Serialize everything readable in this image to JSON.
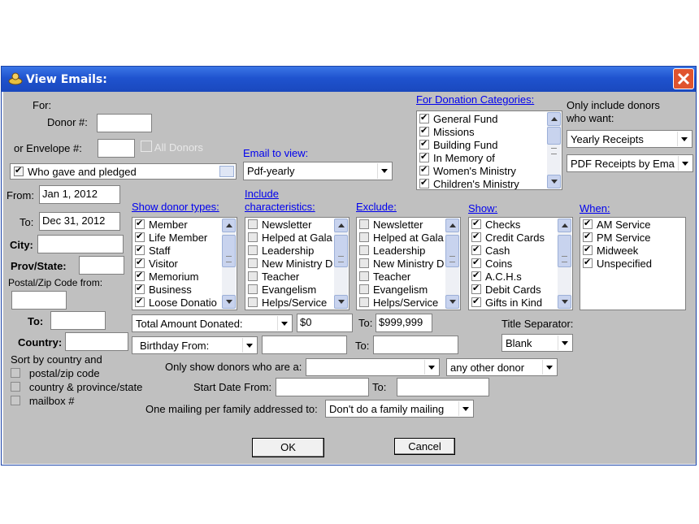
{
  "window": {
    "title": "View Emails:",
    "close": "✕"
  },
  "for_label": "For:",
  "donor": {
    "label": "Donor #:",
    "value": ""
  },
  "envelope": {
    "label": "or Envelope #:",
    "value": ""
  },
  "all_donors": {
    "label": "All Donors",
    "checked": false
  },
  "who_gave": {
    "label": "Who gave and pledged",
    "checked": true
  },
  "email_to_view": {
    "label": "Email to view:",
    "value": "Pdf-yearly"
  },
  "from_date": {
    "label": "From:",
    "value": "Jan 1, 2012"
  },
  "to_date": {
    "label": "To:",
    "value": "Dec 31, 2012"
  },
  "city": {
    "label": "City:",
    "value": ""
  },
  "prov_state": {
    "label": "Prov/State:",
    "value": ""
  },
  "postal": {
    "label": "Postal/Zip Code from:",
    "value": "",
    "to_label": "To:",
    "to_value": ""
  },
  "country": {
    "label": "Country:",
    "value": ""
  },
  "sort": {
    "label": "Sort by country and",
    "options": [
      {
        "label": "postal/zip code",
        "checked": false
      },
      {
        "label": "country & province/state",
        "checked": false
      },
      {
        "label": "mailbox #",
        "checked": false
      }
    ]
  },
  "donation_categories": {
    "label": "For Donation Categories:",
    "items": [
      {
        "label": "General Fund",
        "checked": true
      },
      {
        "label": "Missions",
        "checked": true
      },
      {
        "label": "Building Fund",
        "checked": true
      },
      {
        "label": "In Memory of",
        "checked": true
      },
      {
        "label": "Women's Ministry",
        "checked": true
      },
      {
        "label": "Children's Ministry",
        "checked": true
      }
    ]
  },
  "only_include": {
    "label_line1": "Only include donors",
    "label_line2": "who want:",
    "receipts": "Yearly Receipts",
    "pdf": "PDF Receipts by Ema"
  },
  "donor_types": {
    "label": "Show donor types:",
    "items": [
      {
        "label": "Member",
        "checked": true
      },
      {
        "label": "Life Member",
        "checked": true
      },
      {
        "label": "Staff",
        "checked": true
      },
      {
        "label": "Visitor",
        "checked": true
      },
      {
        "label": "Memorium",
        "checked": true
      },
      {
        "label": "Business",
        "checked": true
      },
      {
        "label": "Loose Donatio",
        "checked": true
      }
    ]
  },
  "include_chars": {
    "label_line1": "Include",
    "label_line2": "characteristics:",
    "items": [
      {
        "label": "Newsletter",
        "checked": false
      },
      {
        "label": "Helped at Gala",
        "checked": false
      },
      {
        "label": "Leadership",
        "checked": false
      },
      {
        "label": "New Ministry D",
        "checked": false
      },
      {
        "label": "Teacher",
        "checked": false
      },
      {
        "label": "Evangelism",
        "checked": false
      },
      {
        "label": "Helps/Service",
        "checked": false
      }
    ]
  },
  "exclude": {
    "label": "Exclude:",
    "items": [
      {
        "label": "Newsletter",
        "checked": false
      },
      {
        "label": "Helped at Gala",
        "checked": false
      },
      {
        "label": "Leadership",
        "checked": false
      },
      {
        "label": "New Ministry D",
        "checked": false
      },
      {
        "label": "Teacher",
        "checked": false
      },
      {
        "label": "Evangelism",
        "checked": false
      },
      {
        "label": "Helps/Service",
        "checked": false
      }
    ]
  },
  "show": {
    "label": "Show:",
    "items": [
      {
        "label": "Checks",
        "checked": true
      },
      {
        "label": "Credit Cards",
        "checked": true
      },
      {
        "label": "Cash",
        "checked": true
      },
      {
        "label": "Coins",
        "checked": true
      },
      {
        "label": "A.C.H.s",
        "checked": true
      },
      {
        "label": "Debit Cards",
        "checked": true
      },
      {
        "label": "Gifts in Kind",
        "checked": true
      }
    ]
  },
  "when": {
    "label": "When:",
    "items": [
      {
        "label": "AM Service",
        "checked": true
      },
      {
        "label": "PM Service",
        "checked": true
      },
      {
        "label": "Midweek",
        "checked": true
      },
      {
        "label": "Unspecified",
        "checked": true
      }
    ]
  },
  "amount": {
    "select": "Total Amount Donated:",
    "from": "$0",
    "to_label": "To:",
    "to": "$999,999"
  },
  "title_sep": {
    "label": "Title Separator:",
    "value": "Blank"
  },
  "birthday": {
    "select": "Birthday From:",
    "from": "",
    "to_label": "To:",
    "to": ""
  },
  "only_show": {
    "label": "Only show donors who are a:",
    "value": "",
    "other": "any other donor"
  },
  "start_date": {
    "label": "Start Date From:",
    "from": "",
    "to_label": "To:",
    "to": ""
  },
  "mailing": {
    "label": "One mailing per family addressed to:",
    "value": "Don't do a family mailing"
  },
  "buttons": {
    "ok": "OK",
    "cancel": "Cancel"
  },
  "colors": {
    "titlebar": "#2457d4",
    "client": "#c0c0c0",
    "link": "#0000ee"
  }
}
